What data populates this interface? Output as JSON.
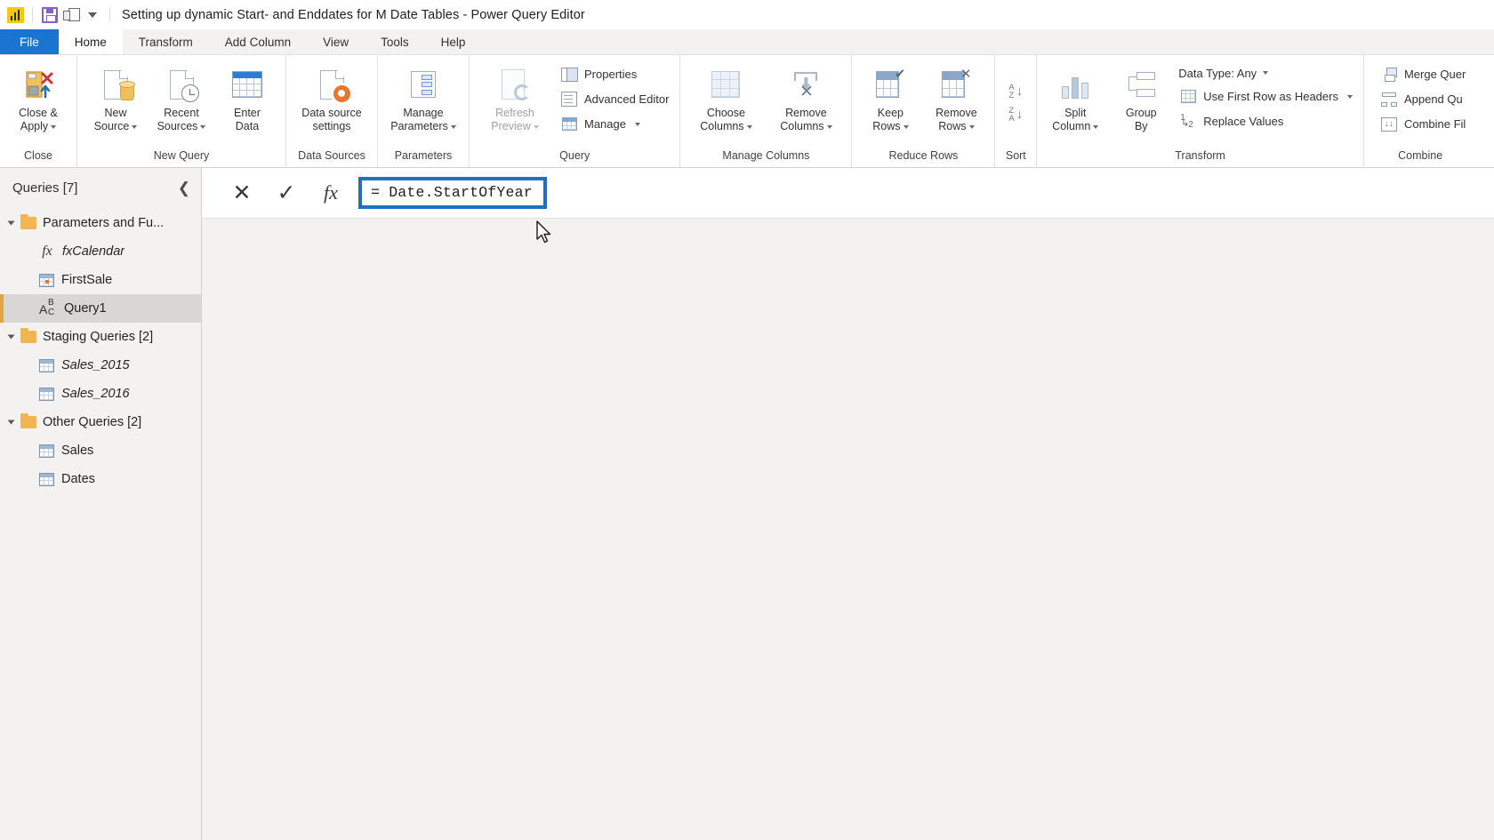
{
  "window": {
    "title": "Setting up dynamic Start- and Enddates for M Date Tables - Power Query Editor",
    "quick_access": {
      "app_icon": "power-bi-icon",
      "save_icon": "save-icon",
      "undo_icon": "undo-icon",
      "customize_icon": "chevron-down-icon"
    }
  },
  "ribbon": {
    "tabs": [
      {
        "label": "File",
        "kind": "file"
      },
      {
        "label": "Home",
        "kind": "active"
      },
      {
        "label": "Transform",
        "kind": "normal"
      },
      {
        "label": "Add Column",
        "kind": "normal"
      },
      {
        "label": "View",
        "kind": "normal"
      },
      {
        "label": "Tools",
        "kind": "normal"
      },
      {
        "label": "Help",
        "kind": "normal"
      }
    ],
    "groups": {
      "close": {
        "label": "Close",
        "close_apply_l1": "Close &",
        "close_apply_l2": "Apply"
      },
      "new_query": {
        "label": "New Query",
        "new_source_l1": "New",
        "new_source_l2": "Source",
        "recent_sources_l1": "Recent",
        "recent_sources_l2": "Sources",
        "enter_data_l1": "Enter",
        "enter_data_l2": "Data"
      },
      "data_sources": {
        "label": "Data Sources",
        "data_source_settings_l1": "Data source",
        "data_source_settings_l2": "settings"
      },
      "parameters": {
        "label": "Parameters",
        "manage_parameters_l1": "Manage",
        "manage_parameters_l2": "Parameters"
      },
      "query": {
        "label": "Query",
        "refresh_preview_l1": "Refresh",
        "refresh_preview_l2": "Preview",
        "properties": "Properties",
        "advanced_editor": "Advanced Editor",
        "manage": "Manage"
      },
      "manage_columns": {
        "label": "Manage Columns",
        "choose_columns_l1": "Choose",
        "choose_columns_l2": "Columns",
        "remove_columns_l1": "Remove",
        "remove_columns_l2": "Columns"
      },
      "reduce_rows": {
        "label": "Reduce Rows",
        "keep_rows_l1": "Keep",
        "keep_rows_l2": "Rows",
        "remove_rows_l1": "Remove",
        "remove_rows_l2": "Rows"
      },
      "sort": {
        "label": "Sort",
        "sort_asc": "A Z",
        "sort_desc": "Z A"
      },
      "transform": {
        "label": "Transform",
        "split_column_l1": "Split",
        "split_column_l2": "Column",
        "group_by_l1": "Group",
        "group_by_l2": "By",
        "data_type": "Data Type: Any",
        "use_first_row_as_headers": "Use First Row as Headers",
        "replace_values": "Replace Values"
      },
      "combine": {
        "label": "Combine",
        "merge_queries": "Merge Quer",
        "append_queries": "Append Qu",
        "combine_files": "Combine Fil"
      }
    }
  },
  "formula_bar": {
    "cancel_icon": "cancel-icon",
    "accept_icon": "checkmark-icon",
    "fx_icon": "fx-icon",
    "value": "= Date.StartOfYear",
    "highlight_color": "#1f6fc4"
  },
  "queries_pane": {
    "title": "Queries [7]",
    "collapse_icon": "chevron-left-icon",
    "items": [
      {
        "label": "Parameters and Fu...",
        "type": "folder",
        "level": 0,
        "icon": "folder-icon",
        "italic": false,
        "selected": false
      },
      {
        "label": "fxCalendar",
        "type": "function",
        "level": 1,
        "icon": "fx-icon",
        "italic": true,
        "selected": false
      },
      {
        "label": "FirstSale",
        "type": "parameter",
        "level": 1,
        "icon": "calendar-icon",
        "italic": false,
        "selected": false
      },
      {
        "label": "Query1",
        "type": "text",
        "level": 1,
        "icon": "abc-icon",
        "italic": false,
        "selected": true
      },
      {
        "label": "Staging Queries [2]",
        "type": "folder",
        "level": 0,
        "icon": "folder-icon",
        "italic": false,
        "selected": false
      },
      {
        "label": "Sales_2015",
        "type": "table",
        "level": 1,
        "icon": "table-icon",
        "italic": true,
        "selected": false
      },
      {
        "label": "Sales_2016",
        "type": "table",
        "level": 1,
        "icon": "table-icon",
        "italic": true,
        "selected": false
      },
      {
        "label": "Other Queries [2]",
        "type": "folder",
        "level": 0,
        "icon": "folder-icon",
        "italic": false,
        "selected": false
      },
      {
        "label": "Sales",
        "type": "table",
        "level": 1,
        "icon": "table-icon",
        "italic": false,
        "selected": false
      },
      {
        "label": "Dates",
        "type": "table",
        "level": 1,
        "icon": "table-icon",
        "italic": false,
        "selected": false
      }
    ]
  },
  "colors": {
    "file_tab": "#1a75d2",
    "selection_bar": "#e8a33d",
    "accent": "#1f6fc4"
  }
}
